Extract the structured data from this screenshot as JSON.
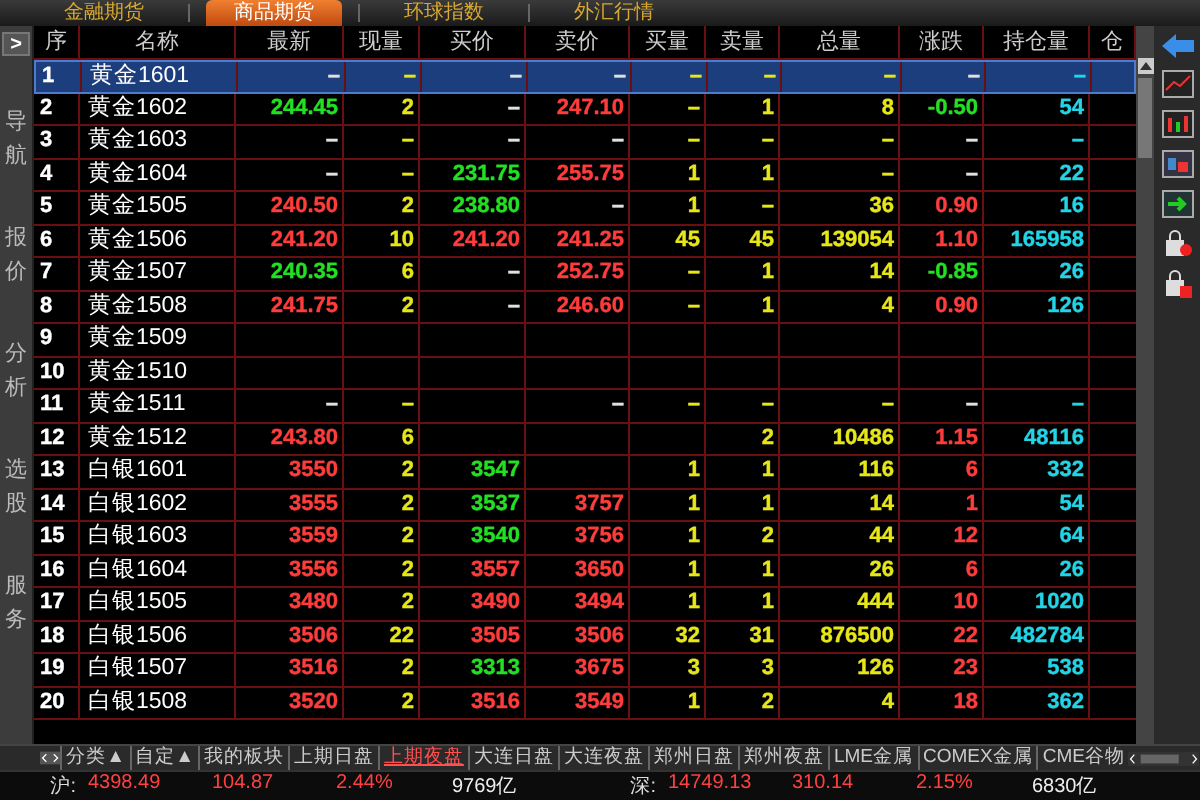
{
  "top_tabs": [
    {
      "label": "金融期货",
      "selected": false
    },
    {
      "label": "商品期货",
      "selected": true
    },
    {
      "label": "环球指数",
      "selected": false
    },
    {
      "label": "外汇行情",
      "selected": false
    }
  ],
  "sidebar": {
    "toggle": ">",
    "items": [
      "导航",
      "报价",
      "分析",
      "选股",
      "服务"
    ]
  },
  "table": {
    "columns": [
      "序",
      "名称",
      "最新",
      "现量",
      "买价",
      "卖价",
      "买量",
      "卖量",
      "总量",
      "涨跌",
      "持仓量",
      "仓"
    ],
    "rows": [
      {
        "no": "1",
        "name": "黄金1601",
        "selected": true,
        "cells": [
          {
            "text": "–"
          },
          {
            "text": "–"
          },
          {
            "text": "–"
          },
          {
            "text": "–"
          },
          {
            "text": "–"
          },
          {
            "text": "–"
          },
          {
            "text": "–"
          },
          {
            "text": "–"
          },
          {
            "text": "–"
          }
        ]
      },
      {
        "no": "2",
        "name": "黄金1602",
        "selected": false,
        "cells": [
          {
            "text": "244.45",
            "rising": false
          },
          {
            "text": "2"
          },
          {
            "text": "–"
          },
          {
            "text": "247.10",
            "rising": true
          },
          {
            "text": "–"
          },
          {
            "text": "1"
          },
          {
            "text": "8"
          },
          {
            "text": "-0.50",
            "rising": false
          },
          {
            "text": "54"
          }
        ]
      },
      {
        "no": "3",
        "name": "黄金1603",
        "selected": false,
        "cells": [
          {
            "text": "–"
          },
          {
            "text": "–"
          },
          {
            "text": "–"
          },
          {
            "text": "–"
          },
          {
            "text": "–"
          },
          {
            "text": "–"
          },
          {
            "text": "–"
          },
          {
            "text": "–"
          },
          {
            "text": "–"
          }
        ]
      },
      {
        "no": "4",
        "name": "黄金1604",
        "selected": false,
        "cells": [
          {
            "text": "–"
          },
          {
            "text": "–"
          },
          {
            "text": "231.75",
            "rising": false
          },
          {
            "text": "255.75",
            "rising": true
          },
          {
            "text": "1"
          },
          {
            "text": "1"
          },
          {
            "text": "–"
          },
          {
            "text": "–"
          },
          {
            "text": "22"
          }
        ]
      },
      {
        "no": "5",
        "name": "黄金1505",
        "selected": false,
        "cells": [
          {
            "text": "240.50",
            "rising": true
          },
          {
            "text": "2"
          },
          {
            "text": "238.80",
            "rising": false
          },
          {
            "text": "–"
          },
          {
            "text": "1"
          },
          {
            "text": "–"
          },
          {
            "text": "36"
          },
          {
            "text": "0.90",
            "rising": true
          },
          {
            "text": "16"
          }
        ]
      },
      {
        "no": "6",
        "name": "黄金1506",
        "selected": false,
        "cells": [
          {
            "text": "241.20",
            "rising": true
          },
          {
            "text": "10"
          },
          {
            "text": "241.20",
            "rising": true
          },
          {
            "text": "241.25",
            "rising": true
          },
          {
            "text": "45"
          },
          {
            "text": "45"
          },
          {
            "text": "139054"
          },
          {
            "text": "1.10",
            "rising": true
          },
          {
            "text": "165958"
          }
        ]
      },
      {
        "no": "7",
        "name": "黄金1507",
        "selected": false,
        "cells": [
          {
            "text": "240.35",
            "rising": false
          },
          {
            "text": "6"
          },
          {
            "text": "–"
          },
          {
            "text": "252.75",
            "rising": true
          },
          {
            "text": "–"
          },
          {
            "text": "1"
          },
          {
            "text": "14"
          },
          {
            "text": "-0.85",
            "rising": false
          },
          {
            "text": "26"
          }
        ]
      },
      {
        "no": "8",
        "name": "黄金1508",
        "selected": false,
        "cells": [
          {
            "text": "241.75",
            "rising": true
          },
          {
            "text": "2"
          },
          {
            "text": "–"
          },
          {
            "text": "246.60",
            "rising": true
          },
          {
            "text": "–"
          },
          {
            "text": "1"
          },
          {
            "text": "4"
          },
          {
            "text": "0.90",
            "rising": true
          },
          {
            "text": "126"
          }
        ]
      },
      {
        "no": "9",
        "name": "黄金1509",
        "selected": false,
        "cells": [
          null,
          null,
          null,
          null,
          null,
          null,
          null,
          null,
          null
        ]
      },
      {
        "no": "10",
        "name": "黄金1510",
        "selected": false,
        "cells": [
          null,
          null,
          null,
          null,
          null,
          null,
          null,
          null,
          null
        ]
      },
      {
        "no": "11",
        "name": "黄金1511",
        "selected": false,
        "cells": [
          {
            "text": "–"
          },
          {
            "text": "–"
          },
          null,
          {
            "text": "–"
          },
          {
            "text": "–"
          },
          {
            "text": "–"
          },
          {
            "text": "–"
          },
          {
            "text": "–"
          },
          {
            "text": "–"
          }
        ]
      },
      {
        "no": "12",
        "name": "黄金1512",
        "selected": false,
        "cells": [
          {
            "text": "243.80",
            "rising": true
          },
          {
            "text": "6"
          },
          null,
          null,
          null,
          {
            "text": "2"
          },
          {
            "text": "10486"
          },
          {
            "text": "1.15",
            "rising": true
          },
          {
            "text": "48116"
          }
        ]
      },
      {
        "no": "13",
        "name": "白银1601",
        "selected": false,
        "cells": [
          {
            "text": "3550",
            "rising": true
          },
          {
            "text": "2"
          },
          {
            "text": "3547",
            "rising": false
          },
          null,
          {
            "text": "1"
          },
          {
            "text": "1"
          },
          {
            "text": "116"
          },
          {
            "text": "6",
            "rising": true
          },
          {
            "text": "332"
          }
        ]
      },
      {
        "no": "14",
        "name": "白银1602",
        "selected": false,
        "cells": [
          {
            "text": "3555",
            "rising": true
          },
          {
            "text": "2"
          },
          {
            "text": "3537",
            "rising": false
          },
          {
            "text": "3757",
            "rising": true
          },
          {
            "text": "1"
          },
          {
            "text": "1"
          },
          {
            "text": "14"
          },
          {
            "text": "1",
            "rising": true
          },
          {
            "text": "54"
          }
        ]
      },
      {
        "no": "15",
        "name": "白银1603",
        "selected": false,
        "cells": [
          {
            "text": "3559",
            "rising": true
          },
          {
            "text": "2"
          },
          {
            "text": "3540",
            "rising": false
          },
          {
            "text": "3756",
            "rising": true
          },
          {
            "text": "1"
          },
          {
            "text": "2"
          },
          {
            "text": "44"
          },
          {
            "text": "12",
            "rising": true
          },
          {
            "text": "64"
          }
        ]
      },
      {
        "no": "16",
        "name": "白银1604",
        "selected": false,
        "cells": [
          {
            "text": "3556",
            "rising": true
          },
          {
            "text": "2"
          },
          {
            "text": "3557",
            "rising": true
          },
          {
            "text": "3650",
            "rising": true
          },
          {
            "text": "1"
          },
          {
            "text": "1"
          },
          {
            "text": "26"
          },
          {
            "text": "6",
            "rising": true
          },
          {
            "text": "26"
          }
        ]
      },
      {
        "no": "17",
        "name": "白银1505",
        "selected": false,
        "cells": [
          {
            "text": "3480",
            "rising": true
          },
          {
            "text": "2"
          },
          {
            "text": "3490",
            "rising": true
          },
          {
            "text": "3494",
            "rising": true
          },
          {
            "text": "1"
          },
          {
            "text": "1"
          },
          {
            "text": "444"
          },
          {
            "text": "10",
            "rising": true
          },
          {
            "text": "1020"
          }
        ]
      },
      {
        "no": "18",
        "name": "白银1506",
        "selected": false,
        "cells": [
          {
            "text": "3506",
            "rising": true
          },
          {
            "text": "22"
          },
          {
            "text": "3505",
            "rising": true
          },
          {
            "text": "3506",
            "rising": true
          },
          {
            "text": "32"
          },
          {
            "text": "31"
          },
          {
            "text": "876500"
          },
          {
            "text": "22",
            "rising": true
          },
          {
            "text": "482784"
          }
        ]
      },
      {
        "no": "19",
        "name": "白银1507",
        "selected": false,
        "cells": [
          {
            "text": "3516",
            "rising": true
          },
          {
            "text": "2"
          },
          {
            "text": "3313",
            "rising": false
          },
          {
            "text": "3675",
            "rising": true
          },
          {
            "text": "3"
          },
          {
            "text": "3"
          },
          {
            "text": "126"
          },
          {
            "text": "23",
            "rising": true
          },
          {
            "text": "538"
          }
        ]
      },
      {
        "no": "20",
        "name": "白银1508",
        "selected": false,
        "cells": [
          {
            "text": "3520",
            "rising": true
          },
          {
            "text": "2"
          },
          {
            "text": "3516",
            "rising": true
          },
          {
            "text": "3549",
            "rising": true
          },
          {
            "text": "1"
          },
          {
            "text": "2"
          },
          {
            "text": "4"
          },
          {
            "text": "18",
            "rising": true
          },
          {
            "text": "362"
          }
        ]
      }
    ]
  },
  "bottom_tabs": [
    {
      "label": "分类▲",
      "selected": false
    },
    {
      "label": "自定▲",
      "selected": false
    },
    {
      "label": "我的板块",
      "selected": false
    },
    {
      "label": "上期日盘",
      "selected": false
    },
    {
      "label": "上期夜盘",
      "selected": true
    },
    {
      "label": "大连日盘",
      "selected": false
    },
    {
      "label": "大连夜盘",
      "selected": false
    },
    {
      "label": "郑州日盘",
      "selected": false
    },
    {
      "label": "郑州夜盘",
      "selected": false
    },
    {
      "label": "LME金属",
      "selected": false
    },
    {
      "label": "COMEX金属",
      "selected": false
    },
    {
      "label": "CME谷物",
      "selected": false
    }
  ],
  "status_bar": [
    {
      "market": "沪:",
      "index": "4398.49",
      "change": "104.87",
      "percent": "2.44%",
      "turnover": "9769亿"
    },
    {
      "market": "深:",
      "index": "14749.13",
      "change": "310.14",
      "percent": "2.15%",
      "turnover": "6830亿"
    }
  ]
}
